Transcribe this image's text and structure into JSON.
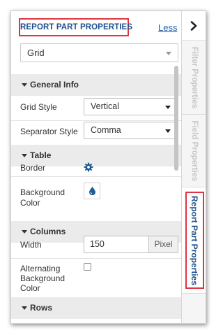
{
  "panel": {
    "title": "REPORT PART PROPERTIES",
    "less_link": "Less",
    "part_type": "Grid"
  },
  "sections": {
    "general_info": "General Info",
    "table": "Table",
    "columns": "Columns",
    "rows": "Rows"
  },
  "fields": {
    "grid_style": {
      "label": "Grid Style",
      "value": "Vertical"
    },
    "separator_style": {
      "label": "Separator Style",
      "value": "Comma"
    },
    "border": {
      "label": "Border",
      "icon": "gear-icon"
    },
    "background_color": {
      "label_line1": "Background",
      "label_line2": "Color",
      "icon": "droplet-icon"
    },
    "width": {
      "label": "Width",
      "value": "150",
      "unit": "Pixel"
    },
    "alternating_background_color": {
      "label_line1": "Alternating",
      "label_line2": "Background",
      "label_line3": "Color",
      "checked": false
    }
  },
  "side_tabs": [
    {
      "label": "Filter Properties",
      "active": false
    },
    {
      "label": "Field Properties",
      "active": false
    },
    {
      "label": "Report Part Properties",
      "active": true
    }
  ],
  "colors": {
    "title_text": "#1e4e8c",
    "highlight_border": "#e0343f",
    "link": "#1e5fa8",
    "section_bg": "#ebebeb",
    "icon_blue": "#1f5d98"
  }
}
